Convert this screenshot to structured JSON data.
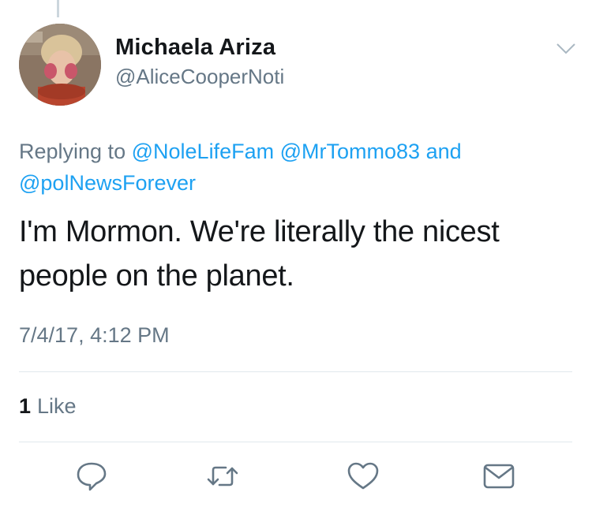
{
  "user": {
    "name": "Michaela Ariza",
    "handle": "@AliceCooperNoti"
  },
  "reply": {
    "prefix": "Replying to",
    "mentions": [
      "@NoleLifeFam",
      "@MrTommo83"
    ],
    "conjunction": "and",
    "last_mention": "@polNewsForever"
  },
  "tweet": {
    "text": "I'm Mormon. We're literally the nicest people on the planet.",
    "timestamp": "7/4/17, 4:12 PM"
  },
  "stats": {
    "like_count": "1",
    "like_label": "Like"
  },
  "actions": {
    "icons": [
      "reply-icon",
      "retweet-icon",
      "like-icon",
      "message-icon"
    ]
  },
  "colors": {
    "link": "#1da1f2",
    "secondary_text": "#657786",
    "primary_text": "#14171a",
    "divider": "#e1e8ed"
  }
}
